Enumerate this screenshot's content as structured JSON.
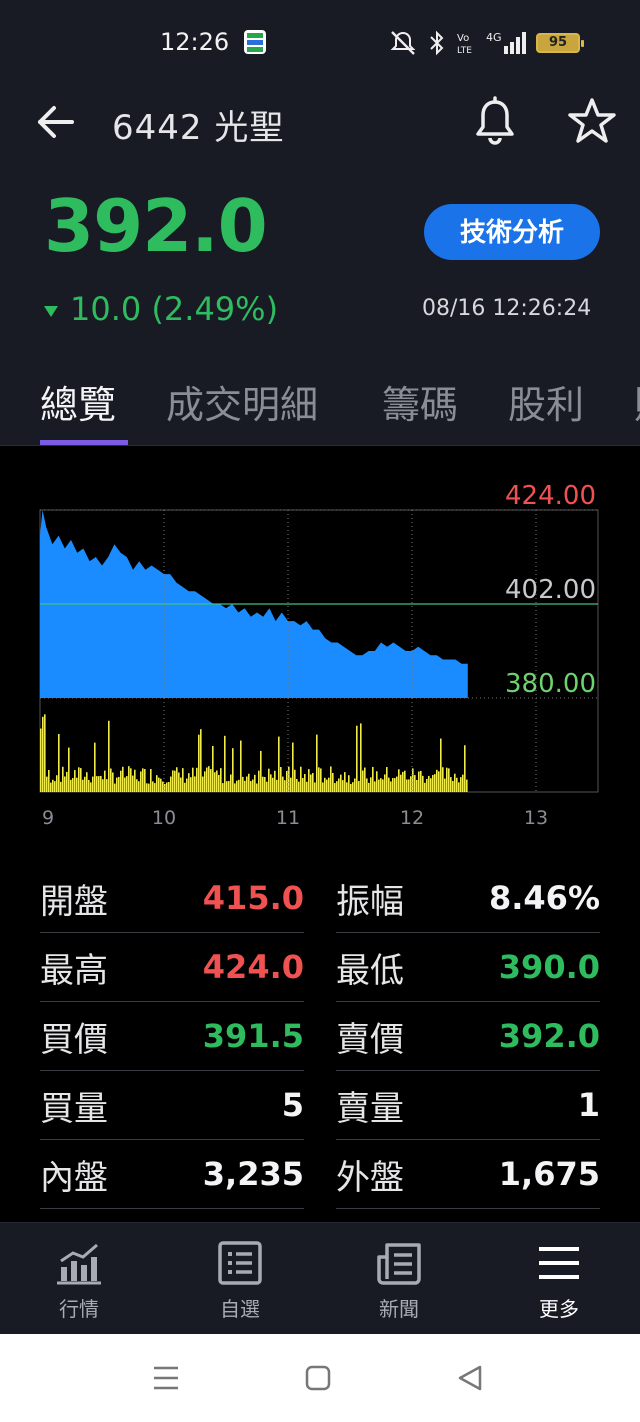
{
  "status_bar": {
    "time": "12:26",
    "icons": [
      "app-notification-icon",
      "mute-icon",
      "bluetooth-icon",
      "volte-icon",
      "signal-4g-icon"
    ],
    "battery": "95"
  },
  "header": {
    "title": "6442 光聖",
    "price": "392.0",
    "change": "10.0 (2.49%)",
    "direction": "down",
    "technical_button": "技術分析",
    "datetime": "08/16 12:26:24",
    "icons": [
      "back-arrow-icon",
      "bell-icon",
      "star-icon"
    ]
  },
  "tabs": [
    {
      "label": "總覽",
      "active": true
    },
    {
      "label": "成交明細",
      "active": false
    },
    {
      "label": "籌碼",
      "active": false
    },
    {
      "label": "股利",
      "active": false
    },
    {
      "label": "財",
      "active": false
    }
  ],
  "chart_data": {
    "type": "area",
    "y_ticks": [
      "424.00",
      "402.00",
      "380.00"
    ],
    "y_tick_values": [
      424.0,
      402.0,
      380.0
    ],
    "reference_price": 402.0,
    "ylim": [
      380.0,
      424.0
    ],
    "x_ticks": [
      "9",
      "10",
      "11",
      "12",
      "13"
    ],
    "x_tick_values": [
      9,
      10,
      11,
      12,
      13
    ],
    "xlim": [
      9,
      13.5
    ],
    "price_series": {
      "x": [
        9.0,
        9.02,
        9.05,
        9.1,
        9.15,
        9.2,
        9.25,
        9.3,
        9.35,
        9.4,
        9.45,
        9.5,
        9.55,
        9.6,
        9.65,
        9.7,
        9.75,
        9.8,
        9.85,
        9.9,
        9.95,
        10.0,
        10.05,
        10.1,
        10.15,
        10.2,
        10.25,
        10.3,
        10.35,
        10.4,
        10.45,
        10.5,
        10.55,
        10.6,
        10.65,
        10.7,
        10.75,
        10.8,
        10.85,
        10.9,
        10.95,
        11.0,
        11.05,
        11.1,
        11.15,
        11.2,
        11.25,
        11.3,
        11.35,
        11.4,
        11.45,
        11.5,
        11.55,
        11.6,
        11.65,
        11.7,
        11.75,
        11.8,
        11.85,
        11.9,
        11.95,
        12.0,
        12.05,
        12.1,
        12.15,
        12.2,
        12.25,
        12.3,
        12.35,
        12.4,
        12.45
      ],
      "y": [
        418,
        424,
        420,
        416,
        418,
        415,
        417,
        414,
        415,
        412,
        413,
        411,
        413,
        416,
        414,
        413,
        410,
        412,
        410,
        411,
        410,
        409,
        409,
        407,
        406,
        405,
        405,
        404,
        403,
        402,
        402,
        401,
        402,
        400,
        401,
        399,
        400,
        399,
        401,
        398,
        400,
        398,
        398,
        397,
        398,
        396,
        396,
        394,
        393,
        393,
        392,
        391,
        390,
        390,
        391,
        391,
        393,
        392,
        393,
        392,
        391,
        391,
        392,
        391,
        390,
        390,
        389,
        389,
        389,
        388,
        388
      ]
    },
    "volume_note": "volume bars (yellow) below price area"
  },
  "stats": {
    "left": [
      {
        "label": "開盤",
        "value": "415.0",
        "color": "red"
      },
      {
        "label": "最高",
        "value": "424.0",
        "color": "red"
      },
      {
        "label": "買價",
        "value": "391.5",
        "color": "green"
      },
      {
        "label": "買量",
        "value": "5",
        "color": "white"
      },
      {
        "label": "內盤",
        "value": "3,235",
        "color": "white"
      }
    ],
    "right": [
      {
        "label": "振幅",
        "value": "8.46%",
        "color": "white"
      },
      {
        "label": "最低",
        "value": "390.0",
        "color": "green"
      },
      {
        "label": "賣價",
        "value": "392.0",
        "color": "green"
      },
      {
        "label": "賣量",
        "value": "1",
        "color": "white"
      },
      {
        "label": "外盤",
        "value": "1,675",
        "color": "white"
      }
    ]
  },
  "bottom_nav": [
    {
      "label": "行情",
      "icon": "chart-bar-icon",
      "active": false
    },
    {
      "label": "自選",
      "icon": "list-icon",
      "active": false
    },
    {
      "label": "新聞",
      "icon": "news-icon",
      "active": false
    },
    {
      "label": "更多",
      "icon": "menu-icon",
      "active": true
    }
  ],
  "colors": {
    "up": "#f05252",
    "down": "#2ebc5f",
    "area": "#1a8cff",
    "volume": "#f2ec4a",
    "accent": "#7c5ce6",
    "button": "#1a73e8"
  }
}
